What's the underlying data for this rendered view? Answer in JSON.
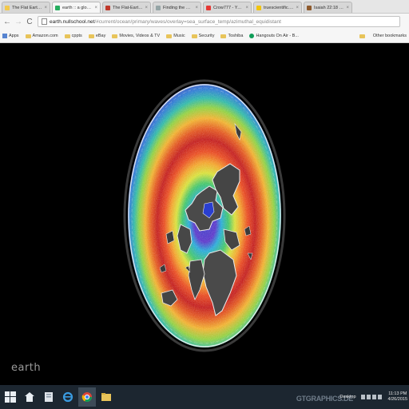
{
  "browser": {
    "tabs": [
      {
        "label": "The Flat Earth Conti",
        "favicon_color": "#f2c94c",
        "active": false
      },
      {
        "label": "earth :: a global map",
        "favicon_color": "#27ae60",
        "active": true
      },
      {
        "label": "The Flat-Earth Bible",
        "favicon_color": "#c0392b",
        "active": false
      },
      {
        "label": "Finding the Garden",
        "favicon_color": "#95a5a6",
        "active": false
      },
      {
        "label": "Crow777 - YouTube",
        "favicon_color": "#e53935",
        "active": false
      },
      {
        "label": "truescientific.com/i",
        "favicon_color": "#f1c40f",
        "active": false
      },
      {
        "label": "Isaiah 22:18 NKJV - I",
        "favicon_color": "#8e5a2d",
        "active": false
      }
    ],
    "tab_close_glyph": "×",
    "nav": {
      "back": "←",
      "forward": "→",
      "reload": "C"
    },
    "url": {
      "host": "earth.nullschool.net",
      "path": "/#current/ocean/primary/waves/overlay=sea_surface_temp/azimuthal_equidistant"
    },
    "bookmarks": [
      {
        "label": "Apps",
        "icon": "apps-icon"
      },
      {
        "label": "Amazon.com",
        "icon": "folder-icon"
      },
      {
        "label": "cppts",
        "icon": "folder-icon"
      },
      {
        "label": "eBay",
        "icon": "folder-icon"
      },
      {
        "label": "Movies, Videos & TV",
        "icon": "folder-icon"
      },
      {
        "label": "Music",
        "icon": "folder-icon"
      },
      {
        "label": "Security",
        "icon": "folder-icon"
      },
      {
        "label": "Toshiba",
        "icon": "folder-icon"
      },
      {
        "label": "Hangouts On Air - B...",
        "icon": "hangouts-icon"
      }
    ],
    "other_bookmarks": "Other bookmarks"
  },
  "page": {
    "app_label": "earth",
    "projection": "azimuthal_equidistant",
    "overlay": "sea_surface_temp"
  },
  "taskbar": {
    "items": [
      "windows-start-icon",
      "store-icon",
      "file-explorer-icon",
      "ie-icon",
      "chrome-icon",
      "folder-icon"
    ],
    "desktop_label": "Desktop",
    "time": "11:13 PM",
    "date": "4/26/2015",
    "watermark": "GTGRAPHICS.DE"
  },
  "colors": {
    "taskbar_bg": "#1c2630",
    "viewport_bg": "#000000"
  }
}
